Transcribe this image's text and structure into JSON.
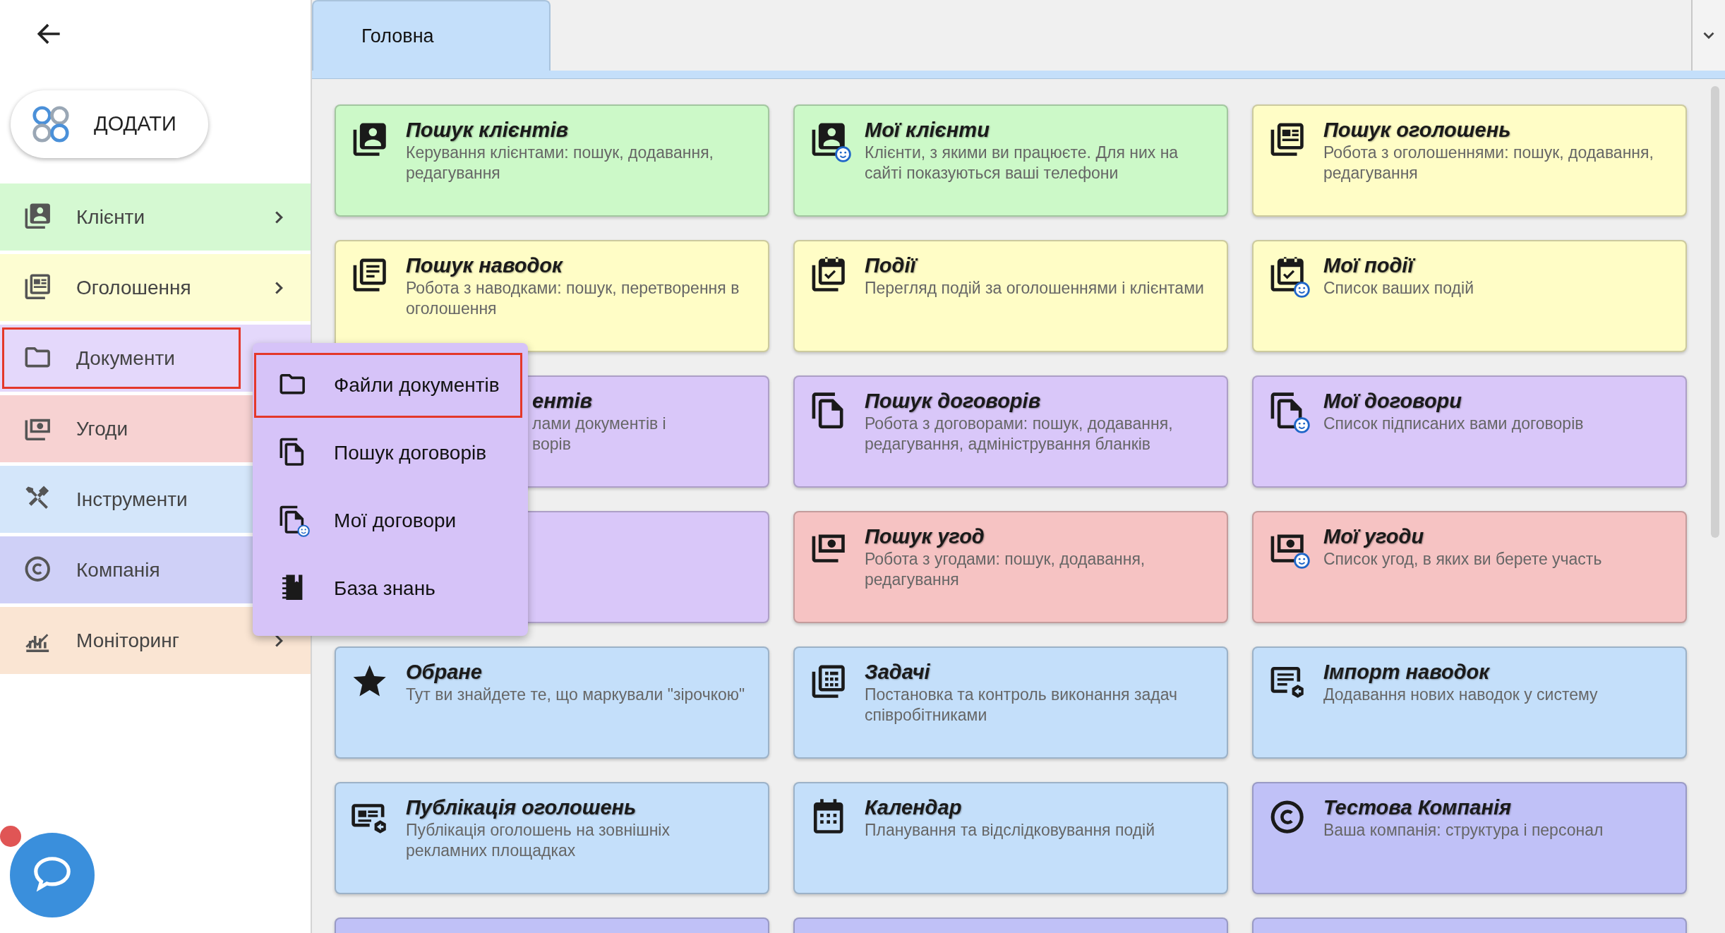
{
  "add_button": {
    "label": "ДОДАТИ"
  },
  "sidebar": {
    "items": [
      {
        "label": "Клієнти",
        "color": "#d5f9d2",
        "expandable": true,
        "highlighted": false
      },
      {
        "label": "Оголошення",
        "color": "#fdfdd2",
        "expandable": true,
        "highlighted": false
      },
      {
        "label": "Документи",
        "color": "#e4d8fb",
        "expandable": false,
        "highlighted": true
      },
      {
        "label": "Угоди",
        "color": "#f7d2d2",
        "expandable": false,
        "highlighted": false
      },
      {
        "label": "Інструменти",
        "color": "#d4e6fa",
        "expandable": false,
        "highlighted": false
      },
      {
        "label": "Компанія",
        "color": "#cfd0f7",
        "expandable": false,
        "highlighted": false
      },
      {
        "label": "Моніторинг",
        "color": "#fae5d3",
        "expandable": true,
        "highlighted": false
      }
    ]
  },
  "submenu": {
    "items": [
      {
        "label": "Файли документів",
        "selected": true
      },
      {
        "label": "Пошук договорів",
        "selected": false
      },
      {
        "label": "Мої договори",
        "selected": false
      },
      {
        "label": "База знань",
        "selected": false
      }
    ]
  },
  "tabs": [
    {
      "label": "Головна",
      "selected": true
    }
  ],
  "cards": [
    {
      "kind": "full",
      "color": "#ccf9c8",
      "title": "Пошук клієнтів",
      "description": "Керування клієнтами: пошук, додавання, редагування"
    },
    {
      "kind": "full",
      "color": "#ccf9c8",
      "title": "Мої клієнти",
      "description": "Клієнти, з якими ви працюєте. Для них на сайті показуються ваші телефони"
    },
    {
      "kind": "full",
      "color": "#fffdc6",
      "title": "Пошук оголошень",
      "description": "Робота з оголошеннями: пошук, додавання, редагування"
    },
    {
      "kind": "full",
      "color": "#fffdc6",
      "title": "Пошук наводок",
      "description": "Робота з наводками: пошук, перетворення в оголошення"
    },
    {
      "kind": "full",
      "color": "#fffdc6",
      "title": "Події",
      "description": "Перегляд подій за оголошеннями і клієнтами"
    },
    {
      "kind": "full",
      "color": "#fffdc6",
      "title": "Мої події",
      "description": "Список ваших подій"
    },
    {
      "kind": "covered",
      "color": "#d9c7f9",
      "title": "ентів",
      "description_fragments": [
        "лами документів і",
        "ворів"
      ]
    },
    {
      "kind": "full",
      "color": "#d9c7f9",
      "title": "Пошук договорів",
      "description": "Робота з договорами: пошук, додавання, редагування, адміністрування бланків"
    },
    {
      "kind": "full",
      "color": "#d9c7f9",
      "title": "Мої договори",
      "description": "Список підписаних вами договорів"
    },
    {
      "kind": "covered",
      "color": "#d9c7f9"
    },
    {
      "kind": "full",
      "color": "#f6c3c3",
      "title": "Пошук угод",
      "description": "Робота з угодами: пошук, додавання, редагування"
    },
    {
      "kind": "full",
      "color": "#f6c3c3",
      "title": "Мої угоди",
      "description": "Список угод, в яких ви берете участь"
    },
    {
      "kind": "full",
      "color": "#c4dffa",
      "title": "Обране",
      "description": "Тут ви знайдете те, що маркували \"зірочкою\""
    },
    {
      "kind": "full",
      "color": "#c4dffa",
      "title": "Задачі",
      "description": "Постановка та контроль виконання задач співробітниками"
    },
    {
      "kind": "full",
      "color": "#c4dffa",
      "title": "Імпорт наводок",
      "description": "Додавання нових наводок у систему"
    },
    {
      "kind": "full",
      "color": "#c4dffa",
      "title": "Публікація оголошень",
      "description": "Публікація оголошень на зовнішніх рекламних площадках"
    },
    {
      "kind": "full",
      "color": "#c4dffa",
      "title": "Календар",
      "description": "Планування та відслідковування подій"
    },
    {
      "kind": "full",
      "color": "#c0c1f7",
      "title": "Тестова Компанія",
      "description": "Ваша компанія: структура і персонал"
    },
    {
      "kind": "cut",
      "color": "#c0c1f7"
    },
    {
      "kind": "cut",
      "color": "#c0c1f7"
    },
    {
      "kind": "cut",
      "color": "#c0c1f7"
    }
  ],
  "chat": {
    "unread": true
  }
}
